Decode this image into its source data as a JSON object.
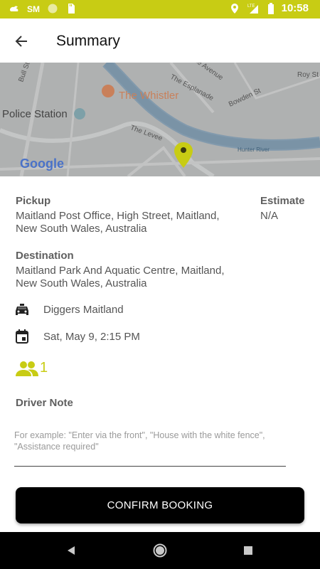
{
  "status_bar": {
    "time": "10:58",
    "left_icons": [
      "cloud-bird-icon",
      "sm-app-icon",
      "circle-icon",
      "sd-card-icon"
    ],
    "right_icons": [
      "location-icon",
      "lte-signal-icon",
      "battery-icon"
    ],
    "color": "#c8cc14"
  },
  "header": {
    "title": "Summary",
    "back_icon": "arrow-back-icon"
  },
  "map": {
    "labels": {
      "poi": "The Whistler",
      "police": "Police Station",
      "street1": "The Esplanade",
      "street2": "Bowden St",
      "street3": "The Levee",
      "street4": "The Avenue",
      "street5": "Roy St",
      "river": "Hunter River",
      "street6": "Bull St"
    },
    "logo": "Google"
  },
  "pickup": {
    "label": "Pickup",
    "value": "Maitland Post Office, High Street, Maitland, New South Wales, Australia"
  },
  "estimate": {
    "label": "Estimate",
    "value": "N/A"
  },
  "destination": {
    "label": "Destination",
    "value": "Maitland Park And Aquatic Centre, Maitland, New South Wales, Australia"
  },
  "company": {
    "icon": "taxi-icon",
    "name": "Diggers Maitland"
  },
  "datetime": {
    "icon": "calendar-icon",
    "value": "Sat, May 9, 2:15 PM"
  },
  "passengers": {
    "icon": "people-icon",
    "count": "1"
  },
  "driver_note": {
    "label": "Driver Note",
    "placeholder": "For example: \"Enter via the front\", \"House with the white fence\", \"Assistance required\""
  },
  "confirm": {
    "label": "CONFIRM BOOKING"
  },
  "nav": {
    "icons": [
      "nav-back-icon",
      "nav-home-icon",
      "nav-recents-icon"
    ]
  },
  "colors": {
    "accent": "#c8cc14",
    "button": "#000000"
  }
}
